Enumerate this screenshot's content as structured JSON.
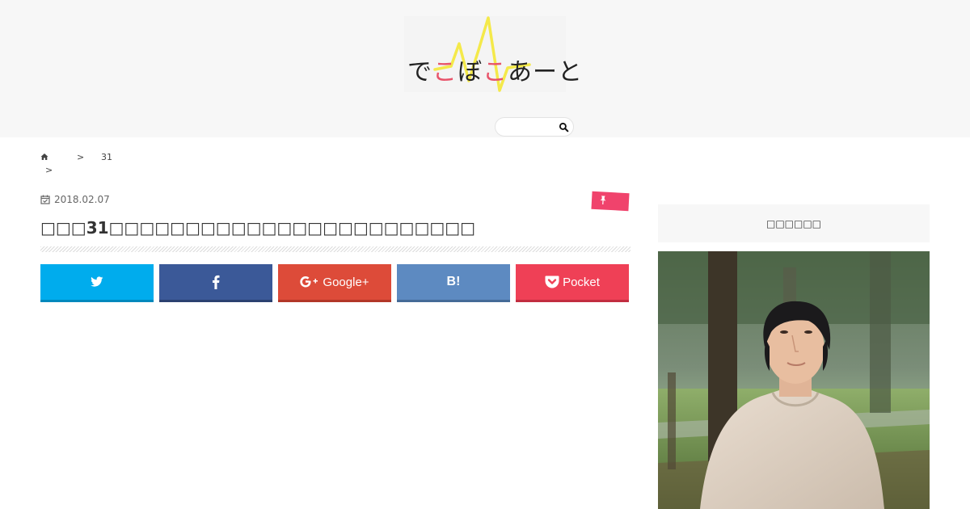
{
  "header": {
    "logo": {
      "parts": [
        "で",
        "こ",
        "ぼ",
        "こ",
        "あーと"
      ]
    },
    "search": {
      "placeholder": "",
      "value": "",
      "icon": "search-icon"
    }
  },
  "breadcrumb": {
    "home_icon": "home-icon",
    "separator_1": ">",
    "item": "31",
    "separator_2": ">"
  },
  "article": {
    "date": "2018.02.07",
    "date_icon": "calendar-check-icon",
    "category_icon": "pin-icon",
    "title": "□□□31□□□□□□□□□□□□□□□□□□□□□□□□"
  },
  "share": {
    "twitter_icon": "twitter-icon",
    "facebook_icon": "facebook-icon",
    "google_label": "Google+",
    "hatena_label": "B!",
    "pocket_label": "Pocket"
  },
  "sidebar": {
    "heading": "□□□□□□"
  },
  "colors": {
    "twitter": "#00aced",
    "facebook": "#3b5998",
    "google": "#dd4b39",
    "hatena": "#5d8ac1",
    "pocket": "#ef4056",
    "category_tag": "#f0436c",
    "logo_pink": "#e8546a",
    "logo_wave": "#f4e94a"
  }
}
